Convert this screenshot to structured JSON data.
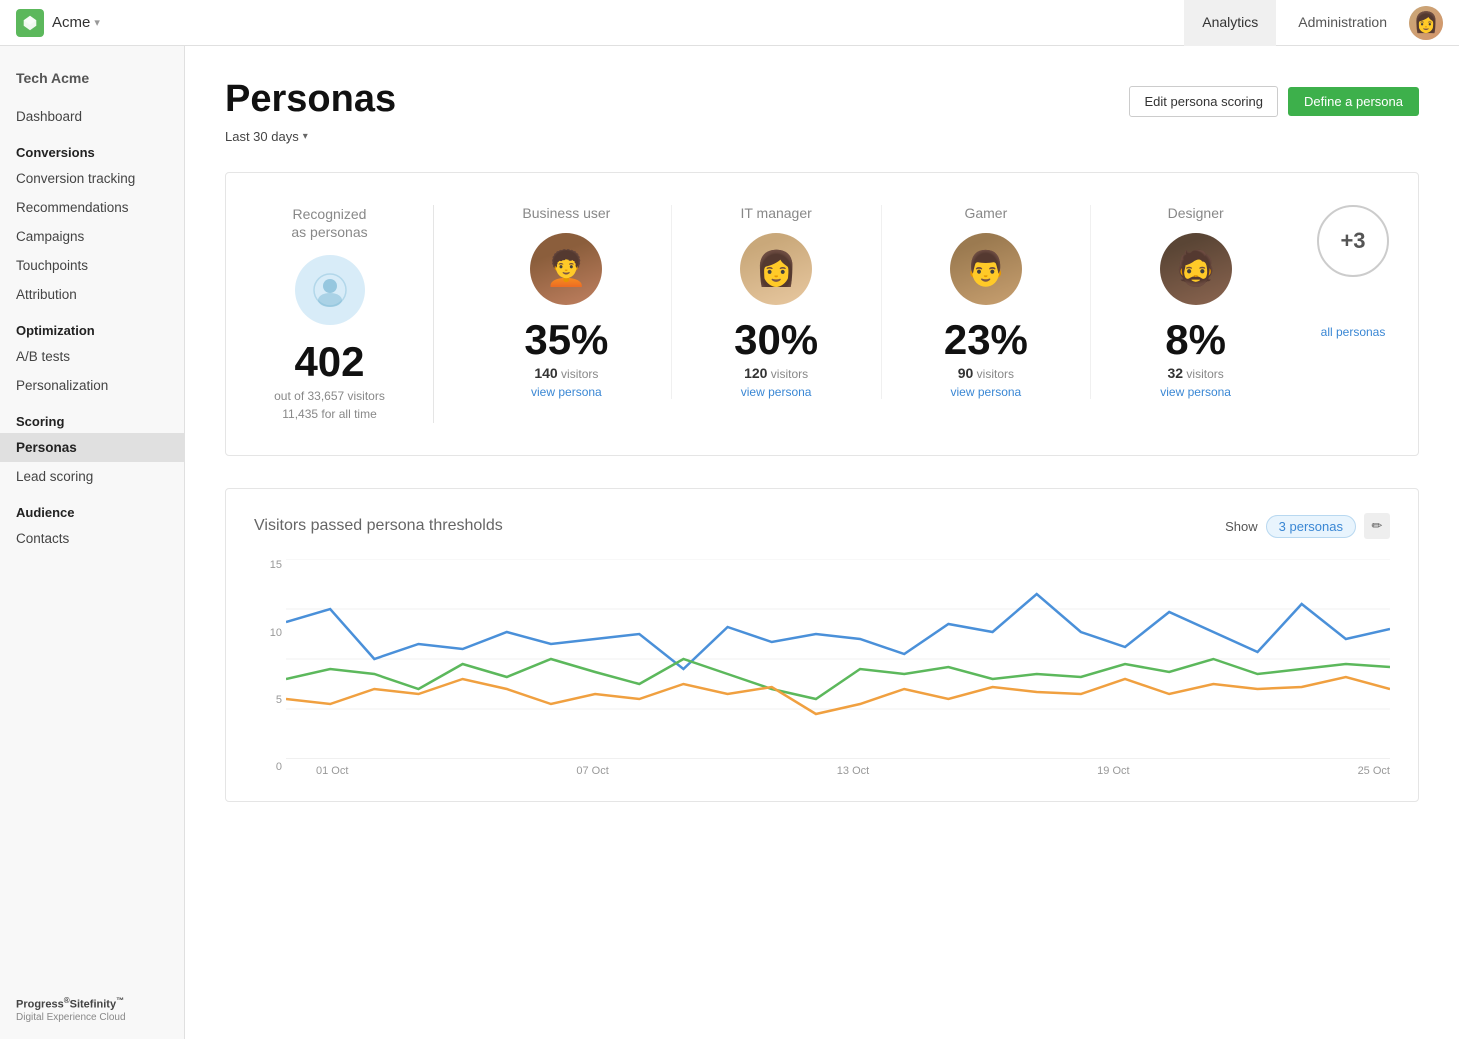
{
  "topNav": {
    "logoAlt": "Sitefinity logo",
    "brand": "Acme",
    "brandChevron": "▾",
    "tabs": [
      {
        "id": "analytics",
        "label": "Analytics",
        "active": true
      },
      {
        "id": "administration",
        "label": "Administration",
        "active": false
      }
    ],
    "avatarInitial": "👩"
  },
  "sidebar": {
    "orgName": "Tech Acme",
    "items": [
      {
        "id": "dashboard",
        "label": "Dashboard",
        "section": null,
        "active": false
      },
      {
        "id": "conversions-header",
        "label": "Conversions",
        "isSection": true
      },
      {
        "id": "conversion-tracking",
        "label": "Conversion tracking",
        "active": false
      },
      {
        "id": "recommendations",
        "label": "Recommendations",
        "active": false
      },
      {
        "id": "campaigns",
        "label": "Campaigns",
        "active": false
      },
      {
        "id": "touchpoints",
        "label": "Touchpoints",
        "active": false
      },
      {
        "id": "attribution",
        "label": "Attribution",
        "active": false
      },
      {
        "id": "optimization-header",
        "label": "Optimization",
        "isSection": true
      },
      {
        "id": "ab-tests",
        "label": "A/B tests",
        "active": false
      },
      {
        "id": "personalization",
        "label": "Personalization",
        "active": false
      },
      {
        "id": "scoring-header",
        "label": "Scoring",
        "isSection": true
      },
      {
        "id": "personas",
        "label": "Personas",
        "active": true
      },
      {
        "id": "lead-scoring",
        "label": "Lead scoring",
        "active": false
      },
      {
        "id": "audience-header",
        "label": "Audience",
        "isSection": true
      },
      {
        "id": "contacts",
        "label": "Contacts",
        "active": false
      }
    ],
    "footer": {
      "line1": "Progress®Sitefinity™",
      "line2": "Digital Experience Cloud"
    }
  },
  "page": {
    "title": "Personas",
    "editButtonLabel": "Edit persona scoring",
    "defineButtonLabel": "Define a persona",
    "dateFilter": "Last 30 days"
  },
  "recognizedSection": {
    "label": "Recognized\nas personas",
    "iconSymbol": "👤",
    "count": "402",
    "subLine1": "out of 33,657 visitors",
    "subLine2": "11,435 for all time"
  },
  "personas": [
    {
      "name": "Business user",
      "percent": "35%",
      "visitorsCount": "140",
      "visitorsLabel": "visitors",
      "viewLink": "view persona",
      "faceClass": "face-1"
    },
    {
      "name": "IT manager",
      "percent": "30%",
      "visitorsCount": "120",
      "visitorsLabel": "visitors",
      "viewLink": "view persona",
      "faceClass": "face-2"
    },
    {
      "name": "Gamer",
      "percent": "23%",
      "visitorsCount": "90",
      "visitorsLabel": "visitors",
      "viewLink": "view persona",
      "faceClass": "face-3"
    },
    {
      "name": "Designer",
      "percent": "8%",
      "visitorsCount": "32",
      "visitorsLabel": "visitors",
      "viewLink": "view persona",
      "faceClass": "face-4"
    }
  ],
  "morePersonas": {
    "label": "+3",
    "linkLabel": "all personas"
  },
  "chart": {
    "title": "Visitors passed persona thresholds",
    "showLabel": "Show",
    "personasBadge": "3 personas",
    "editIcon": "✏",
    "yLabels": [
      "15",
      "10",
      "5",
      "0"
    ],
    "xLabels": [
      "01 Oct",
      "07 Oct",
      "13 Oct",
      "19 Oct",
      "25 Oct"
    ],
    "lines": [
      {
        "color": "#4a90d9",
        "name": "blue-line"
      },
      {
        "color": "#5cb85c",
        "name": "green-line"
      },
      {
        "color": "#f0a040",
        "name": "orange-line"
      }
    ]
  }
}
